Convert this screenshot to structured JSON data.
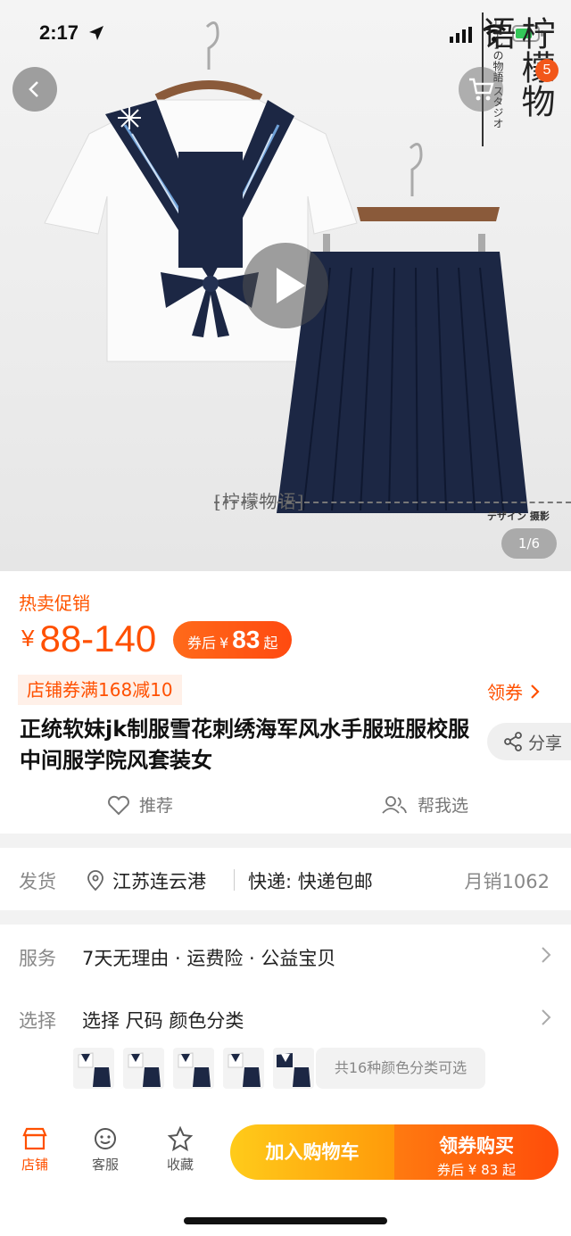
{
  "status_bar": {
    "time": "2:17"
  },
  "hero": {
    "cart_badge": "5",
    "image_counter": "1/6",
    "watermark_title": "柠檬物语",
    "watermark_sub": "レモンの物語 スタジオ",
    "watermark_bottom": "[柠檬物语]",
    "watermark_studio": "デザイン 摄影"
  },
  "price": {
    "promo_label": "热卖促销",
    "currency": "¥",
    "range": "88-140",
    "coupon_prefix": "券后",
    "coupon_currency": "¥",
    "coupon_value": "83",
    "coupon_suffix": "起"
  },
  "coupons": {
    "store_coupon": "店铺券满168减10",
    "get_coupon_label": "领券"
  },
  "product": {
    "title": "正统软妹jk制服雪花刺绣海军风水手服班服校服中间服学院风套装女",
    "share_label": "分享",
    "recommend_label": "推荐",
    "help_pick_label": "帮我选"
  },
  "shipping": {
    "label": "发货",
    "location": "江苏连云港",
    "express": "快递: 快递包邮",
    "monthly_sales": "月销1062"
  },
  "service": {
    "label": "服务",
    "text": "7天无理由 · 运费险 · 公益宝贝"
  },
  "select": {
    "label": "选择",
    "text": "选择 尺码 颜色分类",
    "variants_text": "共16种颜色分类可选"
  },
  "bottom_bar": {
    "store_label": "店铺",
    "service_label": "客服",
    "favorite_label": "收藏",
    "add_cart_label": "加入购物车",
    "buy_label": "领券购买",
    "buy_sub": "券后 ¥ 83 起"
  },
  "colors": {
    "accent": "#ff5000",
    "navy": "#1c2744",
    "cart_button": "#ffb012",
    "buy_button": "#ff5a0c"
  }
}
